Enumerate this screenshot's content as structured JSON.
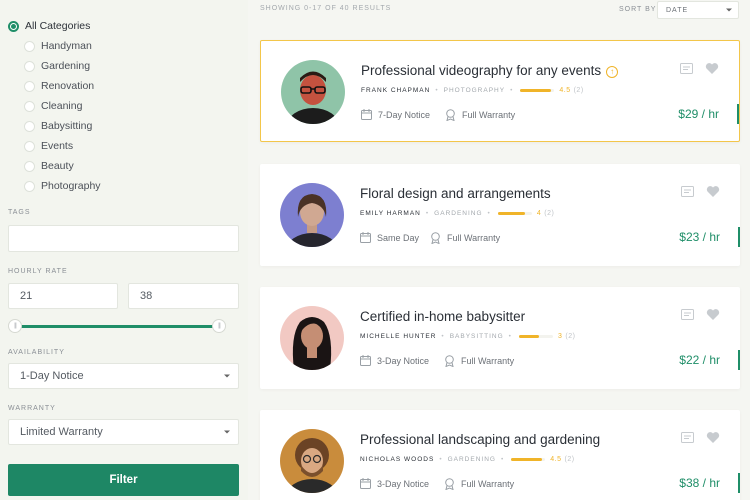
{
  "sidebar": {
    "categories": [
      "All Categories",
      "Handyman",
      "Gardening",
      "Renovation",
      "Cleaning",
      "Babysitting",
      "Events",
      "Beauty",
      "Photography"
    ],
    "selected_category": "All Categories",
    "tags_label": "TAGS",
    "tags_value": "",
    "rate_label": "HOURLY RATE",
    "rate_min": "21",
    "rate_max": "38",
    "availability_label": "AVAILABILITY",
    "availability_value": "1-Day Notice",
    "warranty_label": "WARRANTY",
    "warranty_value": "Limited Warranty",
    "filter_label": "Filter"
  },
  "topbar": {
    "results_text": "SHOWING 0-17 OF 40 RESULTS",
    "sort_label": "SORT BY",
    "sort_value": "DATE"
  },
  "listings": [
    {
      "title": "Professional videography for any events",
      "featured": true,
      "name": "FRANK CHAPMAN",
      "category": "PHOTOGRAPHY",
      "rating": "4.5",
      "rating_fraction": 0.9,
      "reviews": "(2)",
      "availability": "7-Day Notice",
      "warranty": "Full Warranty",
      "price": "$29 / hr"
    },
    {
      "title": "Floral design and arrangements",
      "featured": false,
      "name": "EMILY HARMAN",
      "category": "GARDENING",
      "rating": "4",
      "rating_fraction": 0.8,
      "reviews": "(2)",
      "availability": "Same Day",
      "warranty": "Full Warranty",
      "price": "$23 / hr"
    },
    {
      "title": "Certified in-home babysitter",
      "featured": false,
      "name": "MICHELLE HUNTER",
      "category": "BABYSITTING",
      "rating": "3",
      "rating_fraction": 0.6,
      "reviews": "(2)",
      "availability": "3-Day Notice",
      "warranty": "Full Warranty",
      "price": "$22 / hr"
    },
    {
      "title": "Professional landscaping and gardening",
      "featured": false,
      "name": "NICHOLAS WOODS",
      "category": "GARDENING",
      "rating": "4.5",
      "rating_fraction": 0.9,
      "reviews": "(2)",
      "availability": "3-Day Notice",
      "warranty": "Full Warranty",
      "price": "$38 / hr"
    }
  ],
  "colors": {
    "accent": "#1f8e68",
    "featured_border": "#f3c64a",
    "rating": "#f0b429"
  }
}
